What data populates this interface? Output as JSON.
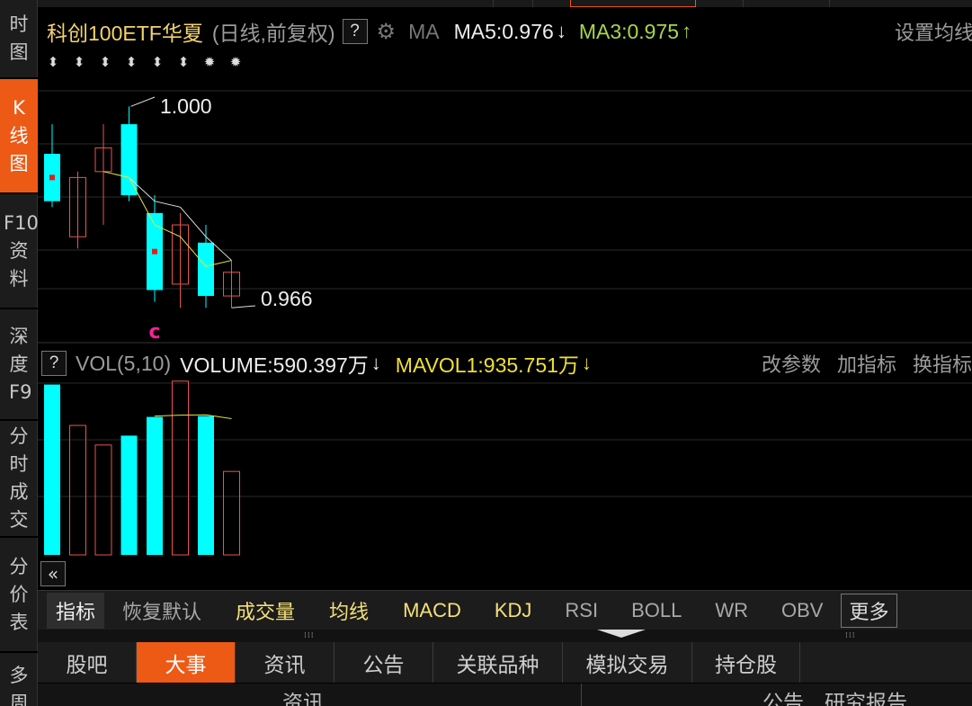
{
  "sidenav": [
    {
      "label": "时图",
      "active": false
    },
    {
      "label": "K线图",
      "active": true
    },
    {
      "label": "F10资料",
      "active": false
    },
    {
      "label": "深度F9",
      "active": false
    },
    {
      "label": "分时成交",
      "active": false
    },
    {
      "label": "分价表",
      "active": false
    },
    {
      "label": "多周",
      "active": false
    }
  ],
  "header": {
    "title": "科创100ETF华夏",
    "subtitle": "(日线,前复权)",
    "help": "?",
    "ma_label": "MA",
    "ma5": "MA5:0.976",
    "ma5_trend": "↓",
    "ma3": "MA3:0.975",
    "ma3_trend": "↑",
    "settings": "设置均线"
  },
  "chart_data": {
    "type": "candlestick",
    "note_high": "1.000",
    "note_low": "0.966",
    "marker": "c",
    "candles": [
      {
        "open": 0.984,
        "close": 0.992,
        "high": 0.997,
        "low": 0.983,
        "dir": "down",
        "flag": true
      },
      {
        "open": 0.978,
        "close": 0.988,
        "high": 0.989,
        "low": 0.976,
        "dir": "up"
      },
      {
        "open": 0.993,
        "close": 0.989,
        "high": 0.997,
        "low": 0.98,
        "dir": "up"
      },
      {
        "open": 0.997,
        "close": 0.985,
        "high": 1.0,
        "low": 0.984,
        "dir": "down"
      },
      {
        "open": 0.982,
        "close": 0.969,
        "high": 0.985,
        "low": 0.967,
        "dir": "down",
        "flag": true
      },
      {
        "open": 0.97,
        "close": 0.98,
        "high": 0.982,
        "low": 0.966,
        "dir": "up"
      },
      {
        "open": 0.977,
        "close": 0.968,
        "high": 0.98,
        "low": 0.966,
        "dir": "down"
      },
      {
        "open": 0.968,
        "close": 0.972,
        "high": 0.974,
        "low": 0.966,
        "dir": "up"
      }
    ],
    "ma_white": [
      null,
      null,
      null,
      0.988,
      0.984,
      0.983,
      0.978,
      0.974
    ],
    "ma_yellow": [
      null,
      null,
      0.989,
      0.988,
      0.98,
      0.978,
      0.973,
      0.974
    ],
    "ylim": [
      0.963,
      1.004
    ],
    "volume": {
      "values": [
        1000,
        760,
        645,
        700,
        810,
        1020,
        815,
        490
      ],
      "dirs": [
        "down",
        "up",
        "up",
        "down",
        "down",
        "up",
        "down",
        "up"
      ],
      "mavol": [
        null,
        null,
        null,
        null,
        815,
        820,
        822,
        800
      ],
      "ylim": [
        0,
        1040
      ]
    }
  },
  "volume_header": {
    "help": "?",
    "label": "VOL(5,10)",
    "volume": "VOLUME:590.397万",
    "volume_trend": "↓",
    "mavol": "MAVOL1:935.751万",
    "mavol_trend": "↓",
    "actions": [
      "改参数",
      "加指标",
      "换指标"
    ]
  },
  "collapse_icon": "«",
  "indicator_bar": {
    "label": "指标",
    "reset": "恢复默认",
    "items": [
      {
        "text": "成交量",
        "color": "yellow"
      },
      {
        "text": "均线",
        "color": "yellow"
      },
      {
        "text": "MACD",
        "color": "yellow"
      },
      {
        "text": "KDJ",
        "color": "yellow"
      },
      {
        "text": "RSI",
        "color": "gray"
      },
      {
        "text": "BOLL",
        "color": "gray"
      },
      {
        "text": "WR",
        "color": "gray"
      },
      {
        "text": "OBV",
        "color": "gray"
      }
    ],
    "more": "更多"
  },
  "bottom_tabs": [
    {
      "text": "股吧",
      "active": false
    },
    {
      "text": "大事",
      "active": true
    },
    {
      "text": "资讯",
      "active": false
    },
    {
      "text": "公告",
      "active": false
    },
    {
      "text": "关联品种",
      "active": false
    },
    {
      "text": "模拟交易",
      "active": false
    },
    {
      "text": "持仓股",
      "active": false
    }
  ],
  "bottom_row": {
    "left": "资讯",
    "right": "公告　研究报告"
  },
  "colors": {
    "up": "#e8554e",
    "down": "#00ffff",
    "ma_white": "#dddddd",
    "ma_yellow": "#e8e23a",
    "accent": "#ec5a16"
  }
}
